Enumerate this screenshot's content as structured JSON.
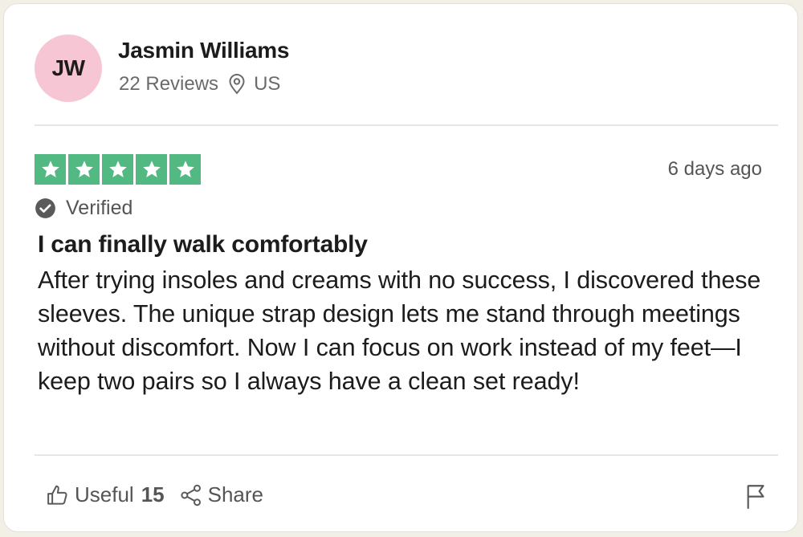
{
  "reviewer": {
    "initials": "JW",
    "name": "Jasmin Williams",
    "reviews_count": "22 Reviews",
    "country": "US",
    "avatar_color": "#f7c6d4",
    "location_icon": "location-pin-icon"
  },
  "review": {
    "rating": 5,
    "rating_max": 5,
    "star_color": "#53b982",
    "date": "6 days ago",
    "verified_label": "Verified",
    "title": "I can finally walk comfortably",
    "body": "After trying insoles and creams with no success, I discovered these sleeves. The unique strap design lets me stand through meetings without discomfort. Now I can focus on work instead of my feet—I keep two pairs so I always have a clean set ready!"
  },
  "actions": {
    "useful_label": "Useful",
    "useful_count": "15",
    "share_label": "Share",
    "useful_icon": "thumbs-up-icon",
    "share_icon": "share-icon",
    "report_icon": "flag-icon"
  }
}
